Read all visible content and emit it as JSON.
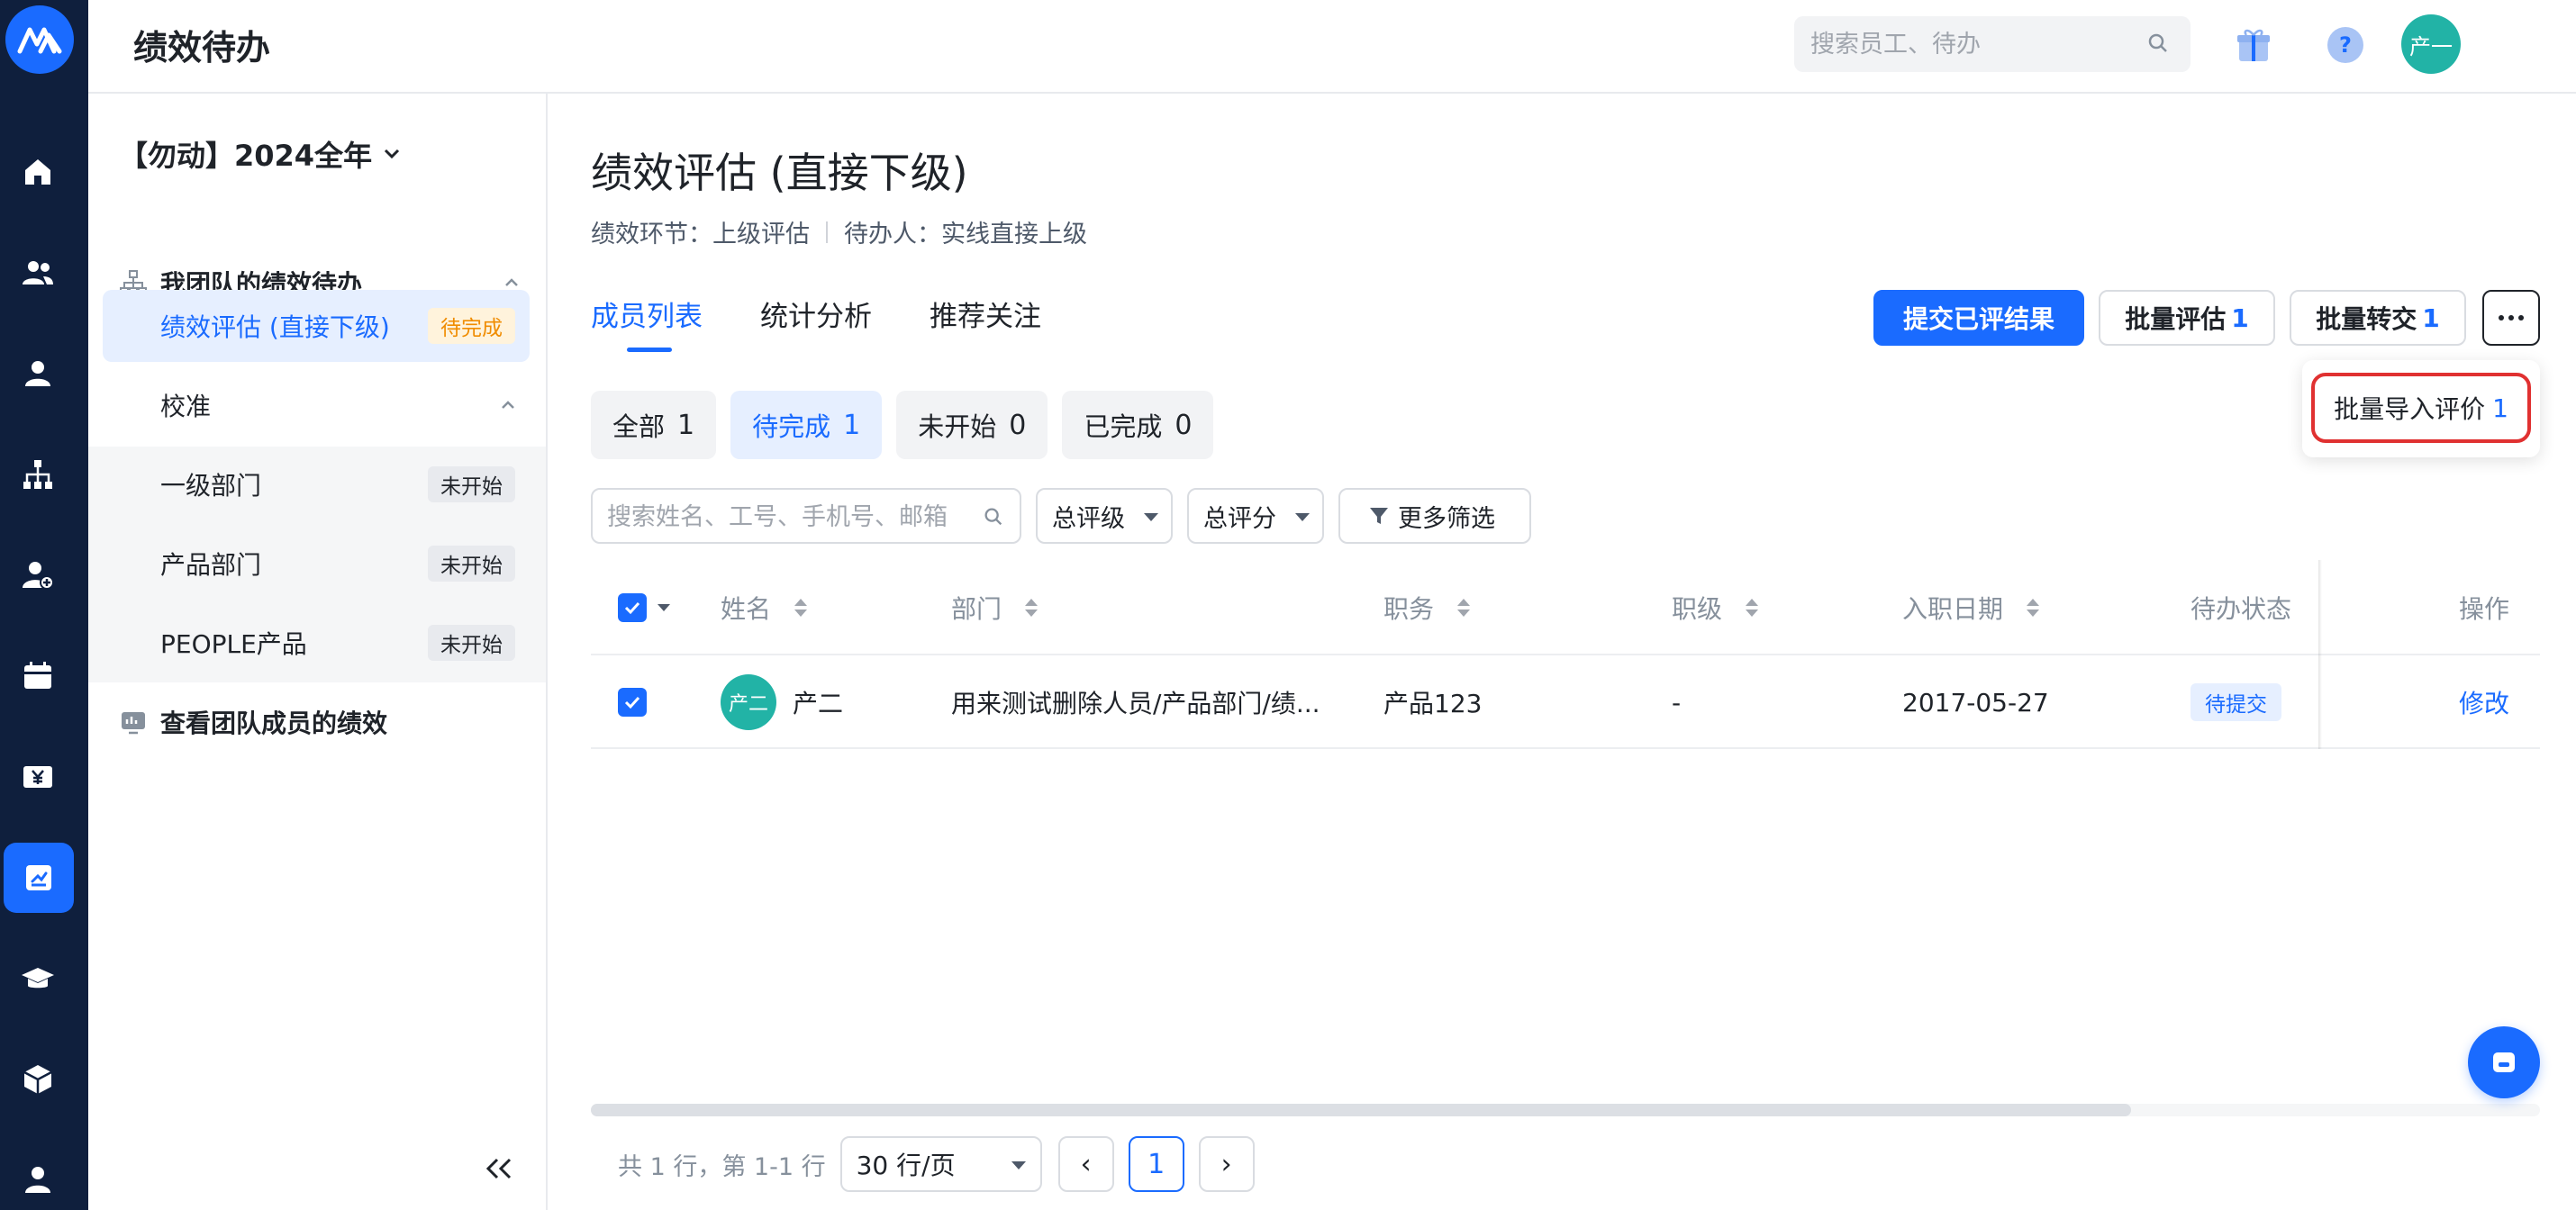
{
  "app": {
    "title": "绩效待办"
  },
  "header": {
    "search_placeholder": "搜索员工、待办",
    "user_avatar": "产一",
    "icons": [
      "gift-icon",
      "help-icon",
      "bell-icon"
    ]
  },
  "rail": {
    "icons": [
      "home-icon",
      "team-icon",
      "person-icon",
      "org-chart-icon",
      "add-person-icon",
      "calendar-icon",
      "salary-icon",
      "performance-icon",
      "learning-icon",
      "package-icon",
      "profile-icon"
    ],
    "active": "performance-icon"
  },
  "sidebar": {
    "cycle": "【勿动】2024全年",
    "section_team": "我团队的绩效待办",
    "items": [
      {
        "label": "绩效评估 (直接下级)",
        "badge": "待完成"
      },
      {
        "label": "校准"
      },
      {
        "label": "一级部门",
        "badge": "未开始"
      },
      {
        "label": "产品部门",
        "badge": "未开始"
      },
      {
        "label": "PEOPLE产品",
        "badge": "未开始"
      }
    ],
    "section_view": "查看团队成员的绩效"
  },
  "main": {
    "title": "绩效评估 (直接下级)",
    "meta_stage_label": "绩效环节：",
    "meta_stage": "上级评估",
    "meta_owner_label": "待办人：",
    "meta_owner": "实线直接上级",
    "tabs": [
      "成员列表",
      "统计分析",
      "推荐关注"
    ],
    "buttons": {
      "submit": "提交已评结果",
      "batch_eval": "批量评估",
      "batch_eval_count": "1",
      "batch_transfer": "批量转交",
      "batch_transfer_count": "1"
    },
    "dropdown": {
      "label": "批量导入评价",
      "count": "1"
    },
    "status_filters": [
      {
        "label": "全部",
        "count": "1"
      },
      {
        "label": "待完成",
        "count": "1"
      },
      {
        "label": "未开始",
        "count": "0"
      },
      {
        "label": "已完成",
        "count": "0"
      }
    ],
    "table_search_placeholder": "搜索姓名、工号、手机号、邮箱",
    "filters": {
      "grade": "总评级",
      "score": "总评分",
      "more": "更多筛选"
    },
    "columns": [
      "姓名",
      "部门",
      "职务",
      "职级",
      "入职日期",
      "待办状态",
      "操作"
    ],
    "rows": [
      {
        "avatar": "产二",
        "name": "产二",
        "department": "用来测试删除人员/产品部门/绩...",
        "position": "产品123",
        "level": "-",
        "hire_date": "2017-05-27",
        "status": "待提交",
        "action": "修改"
      }
    ],
    "pagination": {
      "total": "共 1 行，第 1-1 行",
      "page_size": "30 行/页",
      "prev": "‹",
      "current": "1",
      "next": "›",
      "scroll_fraction": 0.79
    }
  },
  "colors": {
    "accent": "#1a6bff",
    "rail_bg": "#0f1f3d",
    "avatar": "#22b3a6",
    "highlight_border": "#e03131"
  }
}
